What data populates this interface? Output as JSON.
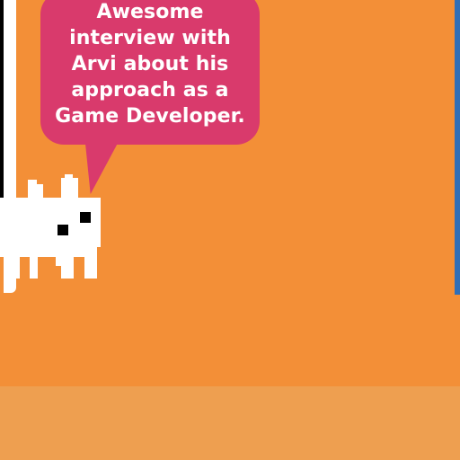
{
  "scene": {
    "speech_bubble": {
      "lines": [
        "Awesome",
        "interview with",
        "Arvi about his",
        "approach as a",
        "Game Developer."
      ]
    },
    "colors": {
      "background": "#f38f37",
      "floor": "#ee9f50",
      "bubble": "#d93a6c",
      "text": "#ffffff",
      "right_panel": "#2f6fb8",
      "character": "#ffffff",
      "eyes": "#000000"
    },
    "icons": {
      "character": "pixel-cat-icon"
    }
  }
}
